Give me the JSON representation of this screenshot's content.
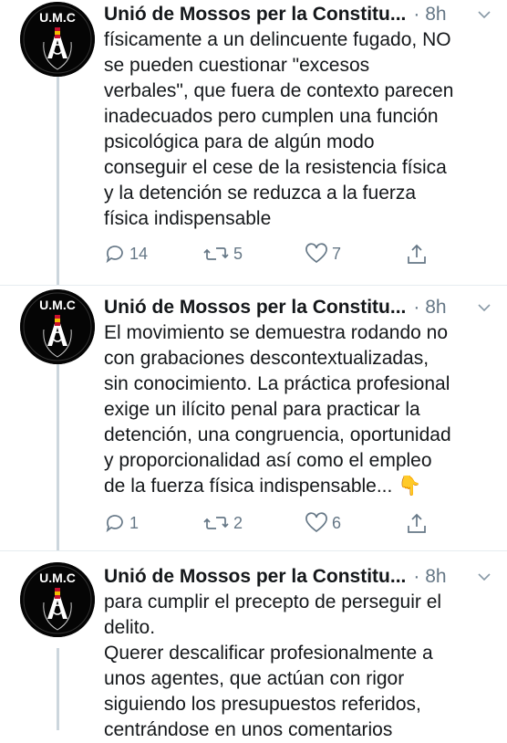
{
  "tweets": [
    {
      "author": "Unió de Mossos per la Constitu...",
      "meta": "· 8h",
      "avatar_text": "U.M.C",
      "avatar_ring": "Unió de Mossos per la Constitució",
      "lines": [
        "físicamente a un delincuente fugado, NO",
        "se pueden cuestionar \"excesos",
        "verbales\", que fuera de contexto parecen",
        "inadecuados pero cumplen una función",
        "psicológica para de algún modo",
        "conseguir el cese de la resistencia física",
        "y la detención se reduzca a la fuerza",
        "física indispensable"
      ],
      "replies": "14",
      "retweets": "5",
      "likes": "7"
    },
    {
      "author": "Unió de Mossos per la Constitu...",
      "meta": "· 8h",
      "avatar_text": "U.M.C",
      "avatar_ring": "Unió de Mossos per la Constitució",
      "lines": [
        "El movimiento se demuestra rodando no",
        "con grabaciones descontextualizadas,",
        "sin conocimiento. La práctica profesional",
        "exige un ilícito penal para practicar la",
        "detención, una congruencia, oportunidad",
        "y proporcionalidad así como el empleo",
        "de la fuerza física indispensable... 👇"
      ],
      "replies": "1",
      "retweets": "2",
      "likes": "6"
    },
    {
      "author": "Unió de Mossos per la Constitu...",
      "meta": "· 8h",
      "avatar_text": "U.M.C",
      "avatar_ring": "Unió de Mossos per la Constitució",
      "lines": [
        "para cumplir el precepto de perseguir el",
        "delito.",
        "Querer descalificar profesionalmente a",
        "unos agentes, que actúan con rigor",
        "siguiendo los presupuestos referidos,",
        "centrándose en unos comentarios"
      ]
    }
  ],
  "colors": {
    "text": "#14171a",
    "muted": "#657786",
    "thread": "#ccd6dd",
    "divider": "#e6ecf0"
  }
}
